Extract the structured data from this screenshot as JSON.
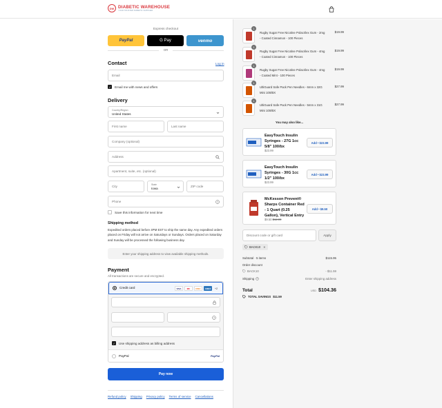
{
  "header": {
    "brand_name": "DIABETIC WAREHOUSE",
    "brand_tagline": "YOUR TRUSTED DIABETIC SUPPLIER",
    "logo_monogram": "DW",
    "cart_icon": "bag-icon"
  },
  "express": {
    "title": "Express checkout",
    "paypal_label": "PayPal",
    "gpay_label": "G Pay",
    "venmo_label": "venmo",
    "or_label": "OR"
  },
  "contact": {
    "title": "Contact",
    "login_link": "Log in",
    "email_placeholder": "Email",
    "news_label": "Email me with news and offers",
    "news_checked": true
  },
  "delivery": {
    "title": "Delivery",
    "country_label": "Country/Region",
    "country_value": "United States",
    "first_name_placeholder": "First name",
    "last_name_placeholder": "Last name",
    "company_placeholder": "Company (optional)",
    "address_placeholder": "Address",
    "apartment_placeholder": "Apartment, suite, etc. (optional)",
    "city_placeholder": "City",
    "state_label": "State",
    "state_value": "Iowa",
    "zip_placeholder": "ZIP code",
    "phone_placeholder": "Phone",
    "save_label": "Save this information for next time",
    "save_checked": false
  },
  "shipping": {
    "title": "Shipping method",
    "info": "Expedited orders placed before 4PM EST to ship the same day. Any expedited orders placed on Friday will not arrive on Saturdays or Sundays. Orders placed on Saturday and Sunday will be processed the following business day.",
    "placeholder_box": "Enter your shipping address to view available shipping methods."
  },
  "payment": {
    "title": "Payment",
    "subtitle": "All transactions are secure and encrypted.",
    "credit_card_label": "Credit card",
    "card_brands": [
      "VISA",
      "MC",
      "DISC",
      "AMEX"
    ],
    "more_brands": "+2",
    "billing_label": "Use shipping address as billing address",
    "billing_checked": true,
    "paypal_option": "PayPal",
    "paypal_logo": "PayPal",
    "pay_now": "Pay now"
  },
  "footer": {
    "links": [
      "Refund policy",
      "Shipping",
      "Privacy policy",
      "Terms of service",
      "Cancellations"
    ]
  },
  "cart": {
    "items": [
      {
        "qty": "1",
        "name": "Rugby Sugar Free Nicotine Polacrilex Gum - 2mg - Coated Cinnamon - 100 Pieces",
        "price": "$19.99",
        "color": "#c0392b"
      },
      {
        "qty": "1",
        "name": "Rugby Sugar Free Nicotine Polacrilex Gum - 4mg - Coated Cinnamon - 100 Pieces",
        "price": "$19.99",
        "color": "#c0392b"
      },
      {
        "qty": "1",
        "name": "Rugby Sugar Free Nicotine Polacrilex Gum - 4mg - Coated Mint - 100 Pieces",
        "price": "$19.99",
        "color": "#b03a7a"
      },
      {
        "qty": "1",
        "name": "UltiGuard Safe Pack Pen Needles - 6mm x 32G Mini 100/BX",
        "price": "$27.99",
        "color": "#d35400"
      },
      {
        "qty": "1",
        "name": "UltiGuard Safe Pack Pen Needles - 5mm x 31G Mini 100/BX",
        "price": "$27.99",
        "color": "#d35400"
      }
    ],
    "also_like": "You may also like...",
    "recommendations": [
      {
        "name": "EasyTouch Insulin Syringes - 27G 1cc 5/8\" 100/bx",
        "price": "$23.99",
        "old_price": "",
        "button": "Add • $23.99",
        "color": "#1f5fbf"
      },
      {
        "name": "EasyTouch Insulin Syringes - 30G 1cc 1/2\" 100/bx",
        "price": "$23.99",
        "old_price": "",
        "button": "Add • $23.99",
        "color": "#1f5fbf"
      },
      {
        "name": "McKesson Prevent® Sharps Container Red - 1 Quart (0.25 Gallon), Vertical Entry",
        "price": "$9.50",
        "old_price": "$12.99",
        "button": "Add • $9.50",
        "color": "#c0392b"
      }
    ],
    "discount_placeholder": "Discount code or gift card",
    "apply_label": "Apply",
    "applied_code": "BACK10",
    "subtotal_label": "Subtotal · 5 items",
    "subtotal_value": "$115.95",
    "order_discount_label": "Order discount",
    "discount_code_line": "BACK10",
    "discount_value": "- $11.59",
    "shipping_label": "Shipping",
    "shipping_value": "Enter shipping address",
    "total_label": "Total",
    "currency": "USD",
    "total_value": "$104.36",
    "savings_label": "TOTAL SAVINGS",
    "savings_value": "$11.59"
  }
}
